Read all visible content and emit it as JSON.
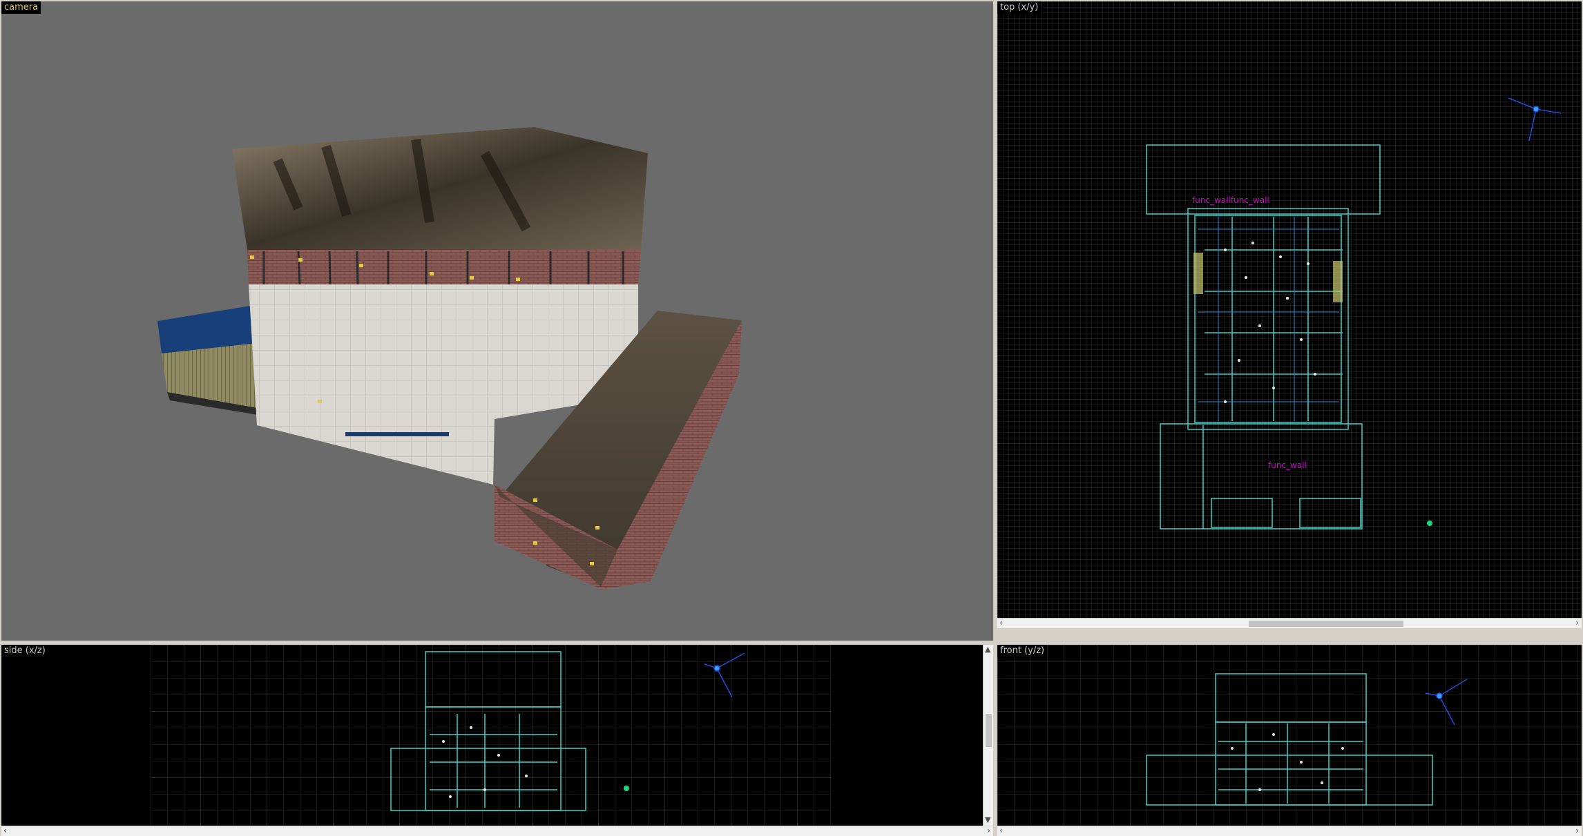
{
  "viewports": {
    "camera": {
      "label": "camera"
    },
    "top": {
      "label": "top (x/y)",
      "entity_labels": [
        "func_wallfunc_wall",
        "func_wall"
      ]
    },
    "side": {
      "label": "side (x/z)"
    },
    "front": {
      "label": "front (y/z)"
    }
  },
  "colors": {
    "camera_bg": "#6b6b6b",
    "ortho_bg": "#000000",
    "grid_minor": "#2a2a2a",
    "grid_major": "#4a4a4a",
    "brush_cyan": "#3fd0c8",
    "entity_magenta": "#d000d0",
    "label_active": "#e8d23a",
    "camera_icon_blue": "#1f4fd8"
  }
}
